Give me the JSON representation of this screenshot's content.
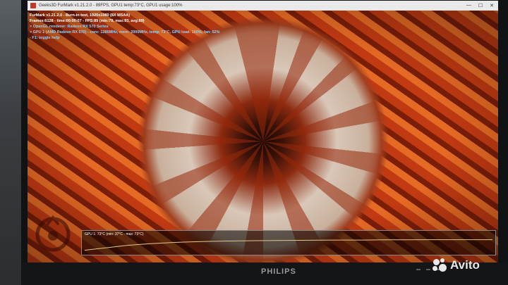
{
  "window": {
    "title": "Geeks3D FurMark v1.21.2.0 - 89FPS, GPU1 temp:73°C, GPU1 usage:100%",
    "controls": [
      "—",
      "☐",
      "✕"
    ]
  },
  "overlay": {
    "lines": [
      "FurMark v1.21.2.0 - Burn-in test, 1920x1080 (8X MSAA)",
      "Frames:6128 - time:00:00:07 - FPS:89 (min:79, max:93, avg:89)",
      "> OpenGL renderer: Radeon RX 570 Series",
      "> GPU 1 (AMD Radeon RX 570) - core: 1286MHz, mem: 2000MHz, temp: 73°C, GPU load: 100%, fan: 52%",
      "- F1: toggle help"
    ]
  },
  "graph": {
    "label": "GPU 1: 73°C (min: 37°C - max: 73°C)",
    "color": "#e0c78a",
    "samples": [
      0.15,
      0.3,
      0.45,
      0.55,
      0.62,
      0.67,
      0.7,
      0.72,
      0.74,
      0.75,
      0.76,
      0.77,
      0.78,
      0.78,
      0.79,
      0.79,
      0.8,
      0.8,
      0.8,
      0.8
    ]
  },
  "monitor": {
    "brand": "PHILIPS"
  },
  "watermark": {
    "text": "Avito"
  },
  "icons": {
    "app": "furmark-app-icon",
    "logo": "furmark-logo-icon"
  }
}
